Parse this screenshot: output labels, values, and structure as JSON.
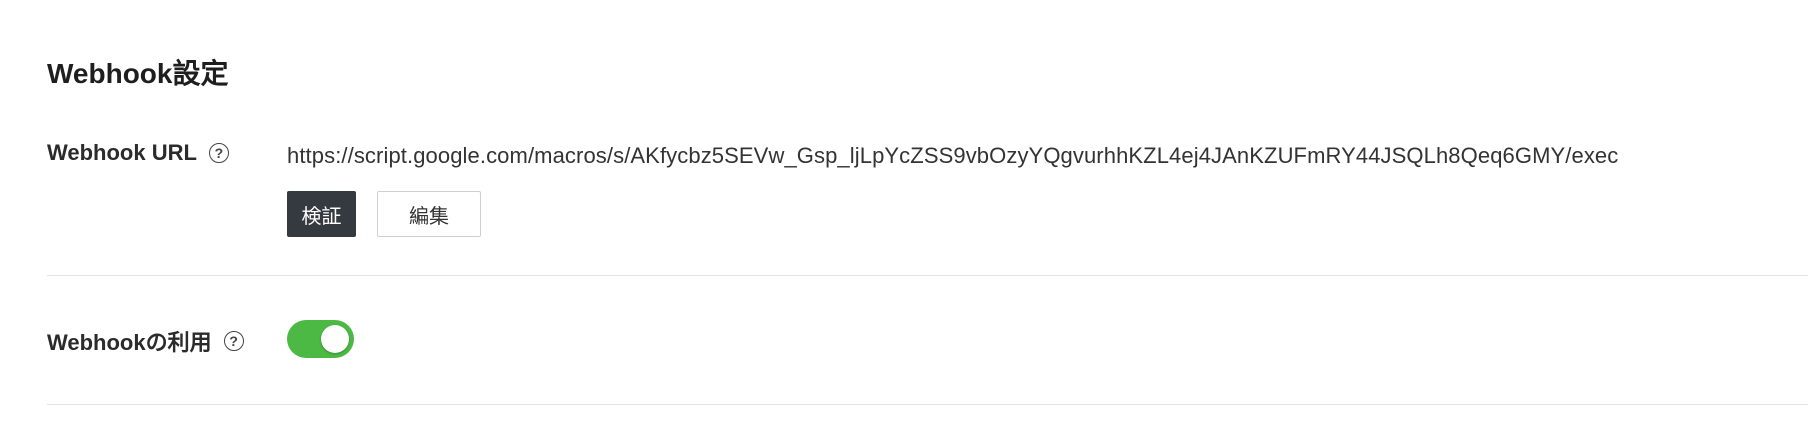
{
  "section": {
    "title": "Webhook設定"
  },
  "webhook_url": {
    "label": "Webhook URL",
    "help_icon": "question-circle-icon",
    "value": "https://script.google.com/macros/s/AKfycbz5SEVw_Gsp_ljLpYcZSS9vbOzyYQgvurhhKZL4ej4JAnKZUFmRY44JSQLh8Qeq6GMY/exec",
    "verify_label": "検証",
    "edit_label": "編集"
  },
  "webhook_usage": {
    "label": "Webhookの利用",
    "help_icon": "question-circle-icon",
    "toggle_on": true,
    "toggle_color": "#4cb944"
  },
  "colors": {
    "primary_button": "#343a40",
    "toggle_on": "#4cb944"
  }
}
